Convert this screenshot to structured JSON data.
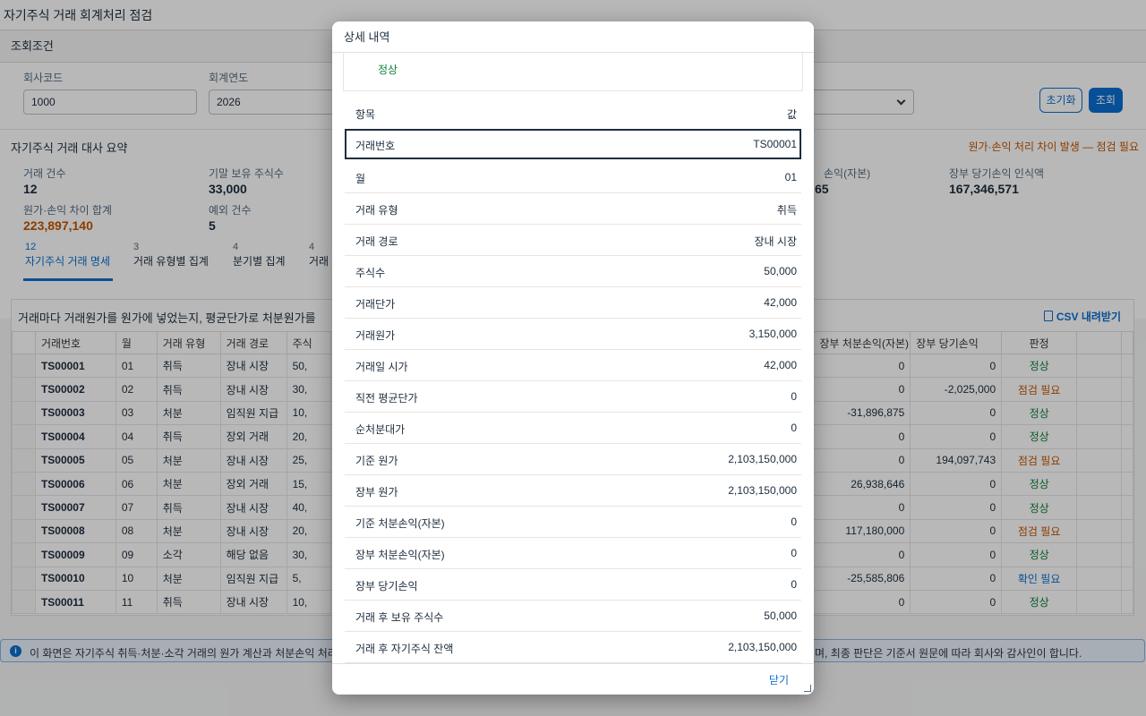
{
  "app_title": "자기주식 거래 회계처리 점검",
  "filters": {
    "section_title": "조회조건",
    "company_code_label": "회사코드",
    "company_code_value": "1000",
    "fiscal_year_label": "회계연도",
    "fiscal_year_value": "2026",
    "reset_label": "초기화",
    "search_label": "조회"
  },
  "summary": {
    "title": "자기주식 거래 대사 요약",
    "warning": "원가·손익 처리 차이 발생 — 점검 필요",
    "kpis": {
      "tx_count_label": "거래 건수",
      "tx_count_value": "12",
      "end_shares_label": "기말 보유 주식수",
      "end_shares_value": "33,000",
      "diff_total_label": "원가·손익 차이 합계",
      "diff_total_value": "223,897,140",
      "exception_label": "예외 건수",
      "exception_value": "5",
      "partial_label": "손익(자본)",
      "partial_value": "65",
      "book_pl_label": "장부 당기손익 인식액",
      "book_pl_value": "167,346,571"
    }
  },
  "tabs": [
    {
      "count": "12",
      "label": "자기주식 거래 명세"
    },
    {
      "count": "3",
      "label": "거래 유형별 집계"
    },
    {
      "count": "4",
      "label": "분기별 집계"
    },
    {
      "count": "4",
      "label": "거래"
    }
  ],
  "table": {
    "title": "거래마다 거래원가를 원가에 넣었는지, 평균단가로 처분원가를",
    "csv_label": "CSV 내려받기",
    "columns": {
      "id": "거래번호",
      "month": "월",
      "type": "거래 유형",
      "route": "거래 경로",
      "shares": "주식",
      "disp_pl": "장부 처분손익(자본)",
      "book_pl": "장부 당기손익",
      "verdict": "판정"
    },
    "rows": [
      {
        "id": "TS00001",
        "month": "01",
        "type": "취득",
        "route": "장내 시장",
        "shares": "50,",
        "disp": "0",
        "pl": "0",
        "verdict": "정상",
        "vclass": "ok"
      },
      {
        "id": "TS00002",
        "month": "02",
        "type": "취득",
        "route": "장내 시장",
        "shares": "30,",
        "disp": "0",
        "pl": "-2,025,000",
        "verdict": "점검 필요",
        "vclass": "chk"
      },
      {
        "id": "TS00003",
        "month": "03",
        "type": "처분",
        "route": "임직원 지급",
        "shares": "10,",
        "disp": "-31,896,875",
        "pl": "0",
        "verdict": "정상",
        "vclass": "ok"
      },
      {
        "id": "TS00004",
        "month": "04",
        "type": "취득",
        "route": "장외 거래",
        "shares": "20,",
        "disp": "0",
        "pl": "0",
        "verdict": "정상",
        "vclass": "ok"
      },
      {
        "id": "TS00005",
        "month": "05",
        "type": "처분",
        "route": "장내 시장",
        "shares": "25,",
        "disp": "0",
        "pl": "194,097,743",
        "verdict": "점검 필요",
        "vclass": "chk"
      },
      {
        "id": "TS00006",
        "month": "06",
        "type": "처분",
        "route": "장외 거래",
        "shares": "15,",
        "disp": "26,938,646",
        "pl": "0",
        "verdict": "정상",
        "vclass": "ok"
      },
      {
        "id": "TS00007",
        "month": "07",
        "type": "취득",
        "route": "장내 시장",
        "shares": "40,",
        "disp": "0",
        "pl": "0",
        "verdict": "정상",
        "vclass": "ok"
      },
      {
        "id": "TS00008",
        "month": "08",
        "type": "처분",
        "route": "장내 시장",
        "shares": "20,",
        "disp": "117,180,000",
        "pl": "0",
        "verdict": "점검 필요",
        "vclass": "chk"
      },
      {
        "id": "TS00009",
        "month": "09",
        "type": "소각",
        "route": "해당 없음",
        "shares": "30,",
        "disp": "0",
        "pl": "0",
        "verdict": "정상",
        "vclass": "ok"
      },
      {
        "id": "TS00010",
        "month": "10",
        "type": "처분",
        "route": "임직원 지급",
        "shares": "5,",
        "disp": "-25,585,806",
        "pl": "0",
        "verdict": "확인 필요",
        "vclass": "cfm"
      },
      {
        "id": "TS00011",
        "month": "11",
        "type": "취득",
        "route": "장내 시장",
        "shares": "10,",
        "disp": "0",
        "pl": "0",
        "verdict": "정상",
        "vclass": "ok"
      }
    ]
  },
  "info_bar": {
    "text_left": "이 화면은 자기주식 취득·처분·소각 거래의 원가 계산과 처분손익 처리",
    "text_right": "며, 최종 판단은 기준서 원문에 따라 회사와 감사인이 합니다."
  },
  "dialog": {
    "title": "상세 내역",
    "status_top": "정상",
    "header_key": "항목",
    "header_value": "값",
    "rows": [
      {
        "k": "거래번호",
        "v": "TS00001"
      },
      {
        "k": "월",
        "v": "01"
      },
      {
        "k": "거래 유형",
        "v": "취득"
      },
      {
        "k": "거래 경로",
        "v": "장내 시장"
      },
      {
        "k": "주식수",
        "v": "50,000"
      },
      {
        "k": "거래단가",
        "v": "42,000"
      },
      {
        "k": "거래원가",
        "v": "3,150,000"
      },
      {
        "k": "거래일 시가",
        "v": "42,000"
      },
      {
        "k": "직전 평균단가",
        "v": "0"
      },
      {
        "k": "순처분대가",
        "v": "0"
      },
      {
        "k": "기준 원가",
        "v": "2,103,150,000"
      },
      {
        "k": "장부 원가",
        "v": "2,103,150,000"
      },
      {
        "k": "기준 처분손익(자본)",
        "v": "0"
      },
      {
        "k": "장부 처분손익(자본)",
        "v": "0"
      },
      {
        "k": "장부 당기손익",
        "v": "0"
      },
      {
        "k": "거래 후 보유 주식수",
        "v": "50,000"
      },
      {
        "k": "거래 후 자기주식 잔액",
        "v": "2,103,150,000"
      }
    ],
    "close_label": "닫기"
  }
}
